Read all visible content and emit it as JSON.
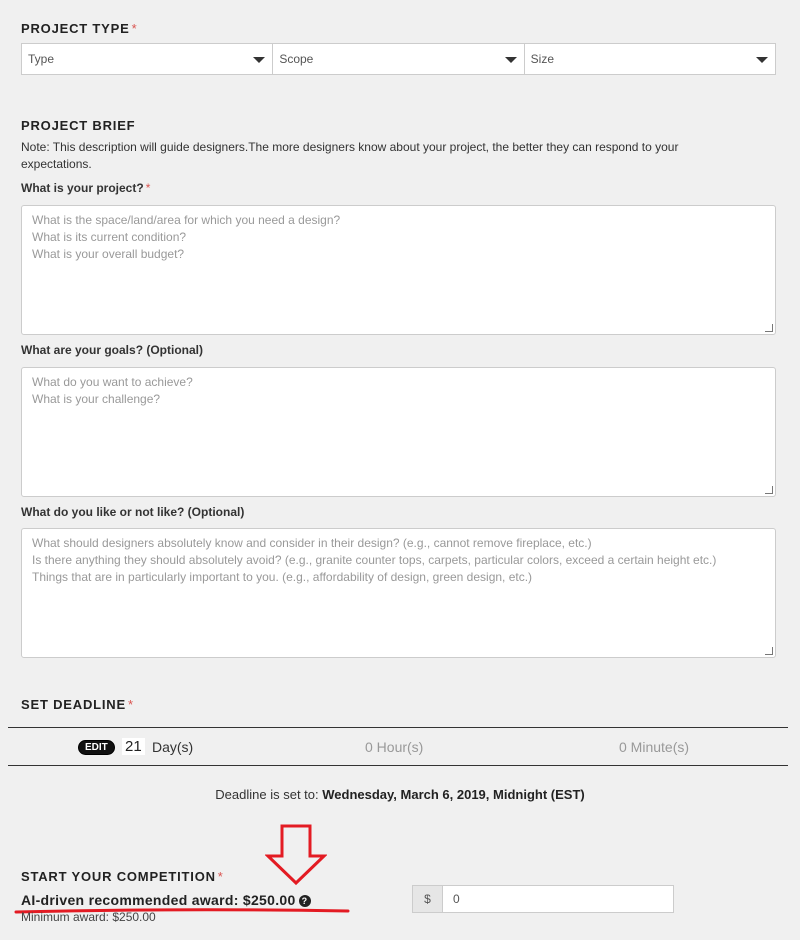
{
  "project_type": {
    "title": "PROJECT TYPE",
    "required_mark": "*",
    "selects": [
      {
        "value": "Type"
      },
      {
        "value": "Scope"
      },
      {
        "value": "Size"
      }
    ]
  },
  "project_brief": {
    "title": "PROJECT BRIEF",
    "note": "Note: This description will guide designers.The more designers know about your project, the better they can respond to your expectations.",
    "q1": {
      "label": "What is your project?",
      "required_mark": "*",
      "placeholder_lines": [
        "What is the space/land/area for which you need a design?",
        "What is its current condition?",
        "What is your overall budget?"
      ]
    },
    "q2": {
      "label": "What are your goals? (Optional)",
      "placeholder_lines": [
        "What do you want to achieve?",
        "What is your challenge?"
      ]
    },
    "q3": {
      "label": "What do you like or not like? (Optional)",
      "placeholder_lines": [
        "What should designers absolutely know and consider in their design? (e.g., cannot remove fireplace, etc.)",
        "Is there anything they should absolutely avoid? (e.g., granite counter tops, carpets, particular colors, exceed a certain height etc.)",
        "Things that are in particularly important to you. (e.g., affordability of design, green design, etc.)"
      ]
    }
  },
  "deadline": {
    "title": "SET DEADLINE",
    "required_mark": "*",
    "edit_label": "EDIT",
    "days_value": "21",
    "days_unit": "Day(s)",
    "hours": "0 Hour(s)",
    "minutes": "0 Minute(s)",
    "info_prefix": "Deadline is set to:",
    "info_value": "Wednesday, March 6, 2019, Midnight (EST)"
  },
  "competition": {
    "title": "START YOUR COMPETITION",
    "required_mark": "*",
    "recommended": "AI-driven recommended award: $250.00",
    "help_icon": "?",
    "minimum": "Minimum award: $250.00",
    "currency": "$",
    "amount": "0"
  },
  "colors": {
    "required": "#d9534f",
    "annotation": "#e31b23"
  }
}
